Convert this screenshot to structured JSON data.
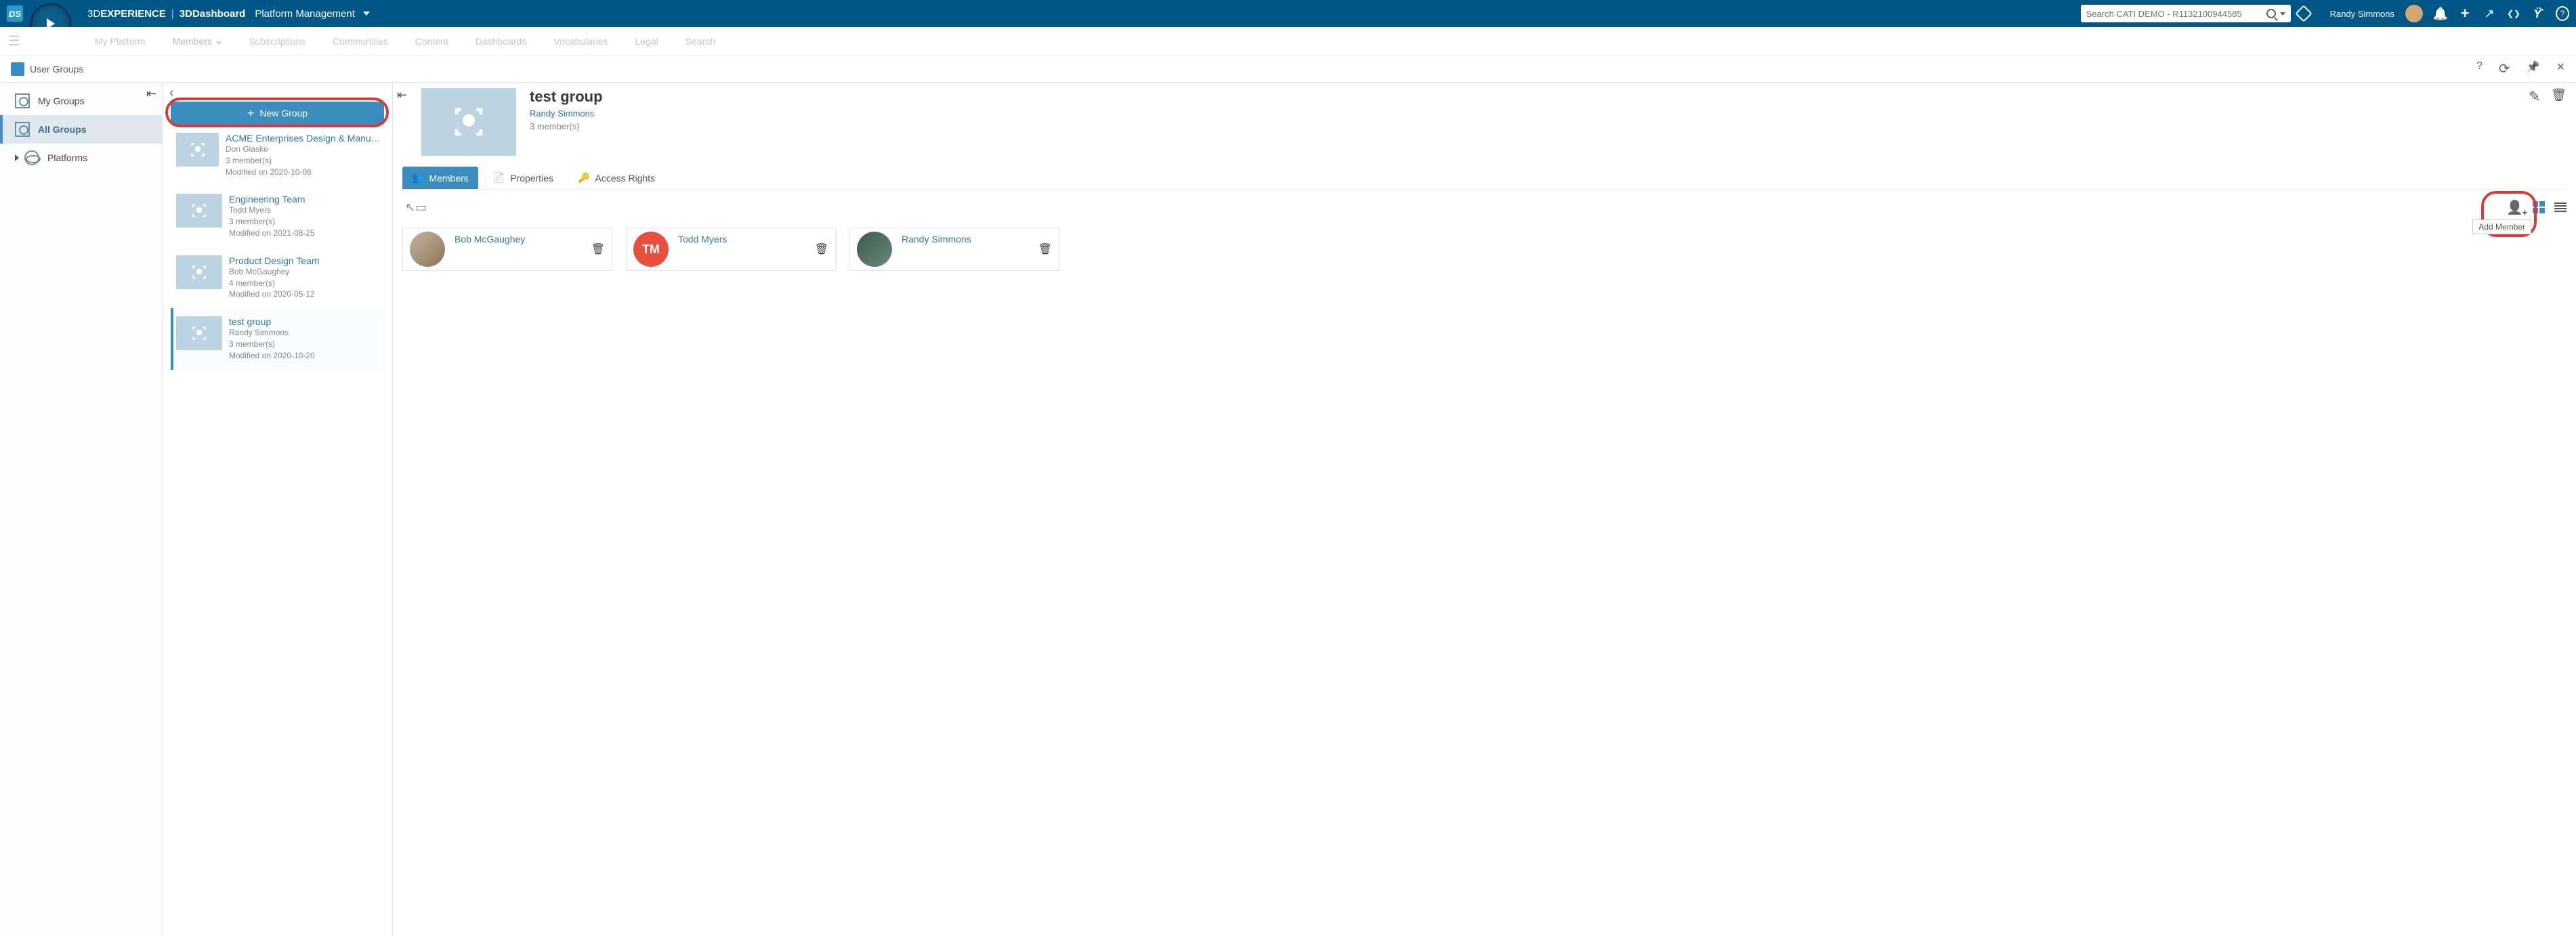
{
  "header": {
    "brand_thin": "3D",
    "brand_bold": "EXPERIENCE",
    "dashboard": "3DDashboard",
    "context": "Platform Management",
    "search_placeholder": "Search CATI DEMO - R1132100944585",
    "user_name": "Randy Simmons"
  },
  "subnav": {
    "items": [
      "My Platform",
      "Members",
      "Subscriptions",
      "Communities",
      "Content",
      "Dashboards",
      "Vocabularies",
      "Legal",
      "Search"
    ],
    "active_index": 1
  },
  "panel": {
    "title": "User Groups"
  },
  "sidebar": {
    "items": [
      {
        "label": "My Groups"
      },
      {
        "label": "All Groups"
      },
      {
        "label": "Platforms"
      }
    ],
    "active_index": 1
  },
  "group_list": {
    "new_button": "New Group",
    "selected_index": 3,
    "items": [
      {
        "name": "ACME Enterprises Design & Manufa…",
        "owner": "Don Glaske",
        "members": "3 member(s)",
        "modified": "Modified on 2020-10-06"
      },
      {
        "name": "Engineering Team",
        "owner": "Todd Myers",
        "members": "3 member(s)",
        "modified": "Modified on 2021-08-25"
      },
      {
        "name": "Product Design Team",
        "owner": "Bob McGaughey",
        "members": "4 member(s)",
        "modified": "Modified on 2020-05-12"
      },
      {
        "name": "test group",
        "owner": "Randy Simmons",
        "members": "3 member(s)",
        "modified": "Modified on 2020-10-20"
      }
    ]
  },
  "detail": {
    "title": "test group",
    "owner": "Randy Simmons",
    "count": "3 member(s)",
    "tabs": [
      {
        "label": "Members"
      },
      {
        "label": "Properties"
      },
      {
        "label": "Access Rights"
      }
    ],
    "active_tab": 0,
    "add_member_tooltip": "Add Member",
    "members": [
      {
        "name": "Bob McGaughey",
        "initials": "",
        "avatar_class": "img1"
      },
      {
        "name": "Todd Myers",
        "initials": "TM",
        "avatar_class": "red"
      },
      {
        "name": "Randy Simmons",
        "initials": "",
        "avatar_class": "img2"
      }
    ]
  }
}
